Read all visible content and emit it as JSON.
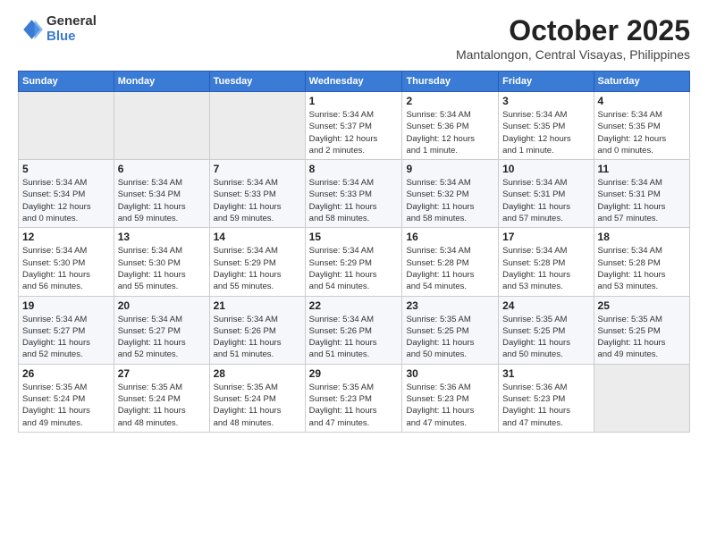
{
  "header": {
    "logo_general": "General",
    "logo_blue": "Blue",
    "month": "October 2025",
    "location": "Mantalongon, Central Visayas, Philippines"
  },
  "days_of_week": [
    "Sunday",
    "Monday",
    "Tuesday",
    "Wednesday",
    "Thursday",
    "Friday",
    "Saturday"
  ],
  "weeks": [
    [
      {
        "day": "",
        "info": ""
      },
      {
        "day": "",
        "info": ""
      },
      {
        "day": "",
        "info": ""
      },
      {
        "day": "1",
        "info": "Sunrise: 5:34 AM\nSunset: 5:37 PM\nDaylight: 12 hours\nand 2 minutes."
      },
      {
        "day": "2",
        "info": "Sunrise: 5:34 AM\nSunset: 5:36 PM\nDaylight: 12 hours\nand 1 minute."
      },
      {
        "day": "3",
        "info": "Sunrise: 5:34 AM\nSunset: 5:35 PM\nDaylight: 12 hours\nand 1 minute."
      },
      {
        "day": "4",
        "info": "Sunrise: 5:34 AM\nSunset: 5:35 PM\nDaylight: 12 hours\nand 0 minutes."
      }
    ],
    [
      {
        "day": "5",
        "info": "Sunrise: 5:34 AM\nSunset: 5:34 PM\nDaylight: 12 hours\nand 0 minutes."
      },
      {
        "day": "6",
        "info": "Sunrise: 5:34 AM\nSunset: 5:34 PM\nDaylight: 11 hours\nand 59 minutes."
      },
      {
        "day": "7",
        "info": "Sunrise: 5:34 AM\nSunset: 5:33 PM\nDaylight: 11 hours\nand 59 minutes."
      },
      {
        "day": "8",
        "info": "Sunrise: 5:34 AM\nSunset: 5:33 PM\nDaylight: 11 hours\nand 58 minutes."
      },
      {
        "day": "9",
        "info": "Sunrise: 5:34 AM\nSunset: 5:32 PM\nDaylight: 11 hours\nand 58 minutes."
      },
      {
        "day": "10",
        "info": "Sunrise: 5:34 AM\nSunset: 5:31 PM\nDaylight: 11 hours\nand 57 minutes."
      },
      {
        "day": "11",
        "info": "Sunrise: 5:34 AM\nSunset: 5:31 PM\nDaylight: 11 hours\nand 57 minutes."
      }
    ],
    [
      {
        "day": "12",
        "info": "Sunrise: 5:34 AM\nSunset: 5:30 PM\nDaylight: 11 hours\nand 56 minutes."
      },
      {
        "day": "13",
        "info": "Sunrise: 5:34 AM\nSunset: 5:30 PM\nDaylight: 11 hours\nand 55 minutes."
      },
      {
        "day": "14",
        "info": "Sunrise: 5:34 AM\nSunset: 5:29 PM\nDaylight: 11 hours\nand 55 minutes."
      },
      {
        "day": "15",
        "info": "Sunrise: 5:34 AM\nSunset: 5:29 PM\nDaylight: 11 hours\nand 54 minutes."
      },
      {
        "day": "16",
        "info": "Sunrise: 5:34 AM\nSunset: 5:28 PM\nDaylight: 11 hours\nand 54 minutes."
      },
      {
        "day": "17",
        "info": "Sunrise: 5:34 AM\nSunset: 5:28 PM\nDaylight: 11 hours\nand 53 minutes."
      },
      {
        "day": "18",
        "info": "Sunrise: 5:34 AM\nSunset: 5:28 PM\nDaylight: 11 hours\nand 53 minutes."
      }
    ],
    [
      {
        "day": "19",
        "info": "Sunrise: 5:34 AM\nSunset: 5:27 PM\nDaylight: 11 hours\nand 52 minutes."
      },
      {
        "day": "20",
        "info": "Sunrise: 5:34 AM\nSunset: 5:27 PM\nDaylight: 11 hours\nand 52 minutes."
      },
      {
        "day": "21",
        "info": "Sunrise: 5:34 AM\nSunset: 5:26 PM\nDaylight: 11 hours\nand 51 minutes."
      },
      {
        "day": "22",
        "info": "Sunrise: 5:34 AM\nSunset: 5:26 PM\nDaylight: 11 hours\nand 51 minutes."
      },
      {
        "day": "23",
        "info": "Sunrise: 5:35 AM\nSunset: 5:25 PM\nDaylight: 11 hours\nand 50 minutes."
      },
      {
        "day": "24",
        "info": "Sunrise: 5:35 AM\nSunset: 5:25 PM\nDaylight: 11 hours\nand 50 minutes."
      },
      {
        "day": "25",
        "info": "Sunrise: 5:35 AM\nSunset: 5:25 PM\nDaylight: 11 hours\nand 49 minutes."
      }
    ],
    [
      {
        "day": "26",
        "info": "Sunrise: 5:35 AM\nSunset: 5:24 PM\nDaylight: 11 hours\nand 49 minutes."
      },
      {
        "day": "27",
        "info": "Sunrise: 5:35 AM\nSunset: 5:24 PM\nDaylight: 11 hours\nand 48 minutes."
      },
      {
        "day": "28",
        "info": "Sunrise: 5:35 AM\nSunset: 5:24 PM\nDaylight: 11 hours\nand 48 minutes."
      },
      {
        "day": "29",
        "info": "Sunrise: 5:35 AM\nSunset: 5:23 PM\nDaylight: 11 hours\nand 47 minutes."
      },
      {
        "day": "30",
        "info": "Sunrise: 5:36 AM\nSunset: 5:23 PM\nDaylight: 11 hours\nand 47 minutes."
      },
      {
        "day": "31",
        "info": "Sunrise: 5:36 AM\nSunset: 5:23 PM\nDaylight: 11 hours\nand 47 minutes."
      },
      {
        "day": "",
        "info": ""
      }
    ]
  ]
}
